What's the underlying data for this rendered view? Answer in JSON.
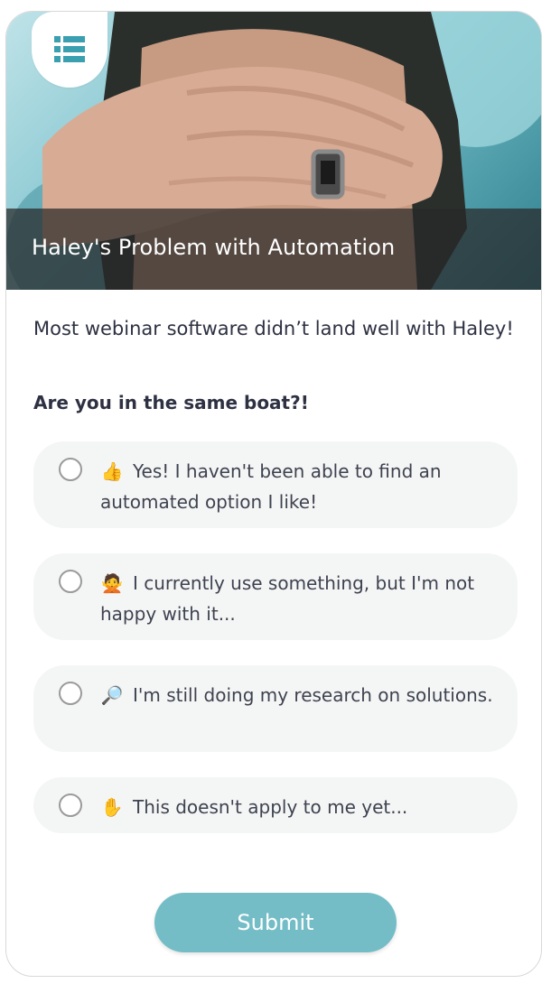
{
  "hero": {
    "title": "Haley's Problem with Automation",
    "image_description_icon": "photo-hands-over-face"
  },
  "menu": {
    "icon": "list-icon",
    "accent_color": "#3aa0b0"
  },
  "content": {
    "intro": "Most webinar software didn’t land well with Haley!",
    "question": "Are you in the same boat?!"
  },
  "options": [
    {
      "emoji": "👍",
      "label": "Yes! I haven't been able to find an automated option I like!"
    },
    {
      "emoji": "🙅",
      "label": "I currently use something, but I'm not happy with it..."
    },
    {
      "emoji": "🔎",
      "label": "I'm still doing my research on solutions."
    },
    {
      "emoji": "✋",
      "label": "This doesn't apply to me yet..."
    }
  ],
  "submit": {
    "label": "Submit",
    "color": "#74bdc6"
  }
}
